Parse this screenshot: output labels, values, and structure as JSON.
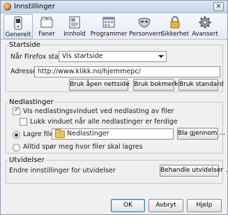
{
  "window": {
    "title": "Innstillinger",
    "close_glyph": "✕"
  },
  "toolbar": {
    "items": [
      {
        "label": "Generelt",
        "icon": "general-switch-icon",
        "active": true
      },
      {
        "label": "Faner",
        "icon": "tabs-icon"
      },
      {
        "label": "Innhold",
        "icon": "content-icon"
      },
      {
        "label": "Programmer",
        "icon": "applications-icon"
      },
      {
        "label": "Personvern",
        "icon": "privacy-mask-icon"
      },
      {
        "label": "Sikkerhet",
        "icon": "security-lock-icon"
      },
      {
        "label": "Avansert",
        "icon": "advanced-gear-icon"
      }
    ]
  },
  "startup": {
    "title": "Startside",
    "when_label": "Når Firefox starter:",
    "when_value": "Vis startside",
    "address_label": "Adresse:",
    "address_value": "http://www.klikk.no/hjemmepc/",
    "use_current_button": "Bruk åpen nettside",
    "use_bookmark_button": "Bruk bokmerke",
    "use_default_button": "Bruk standard"
  },
  "downloads": {
    "title": "Nedlastinger",
    "show_window_label": "Vis nedlastingsvinduet ved nedlasting av filer",
    "show_window_checked": true,
    "close_when_done_label": "Lukk vinduet når alle nedlastinger er ferdige",
    "close_when_done_checked": false,
    "save_to_label": "Lagre filer i",
    "save_to_folder": "Nedlastinger",
    "browse_button": "Bla gjennom ...",
    "always_ask_label": "Alltid spør meg hvor filer skal lagres"
  },
  "addons": {
    "title": "Utvidelser",
    "description": "Endre innstillinger for utvidelser",
    "manage_button": "Behandle utvidelser ..."
  },
  "footer": {
    "ok": "OK",
    "cancel": "Avbryt",
    "help": "Hjelp"
  },
  "colors": {
    "accent": "#3c7fb1",
    "window_bg": "#f0f0f0"
  }
}
